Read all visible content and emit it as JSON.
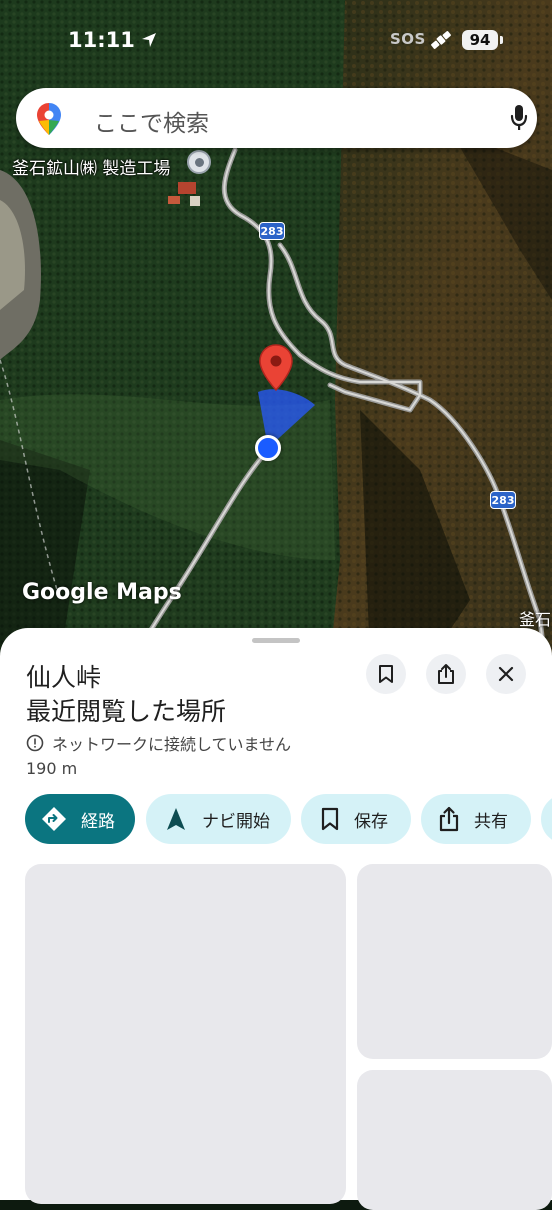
{
  "status_bar": {
    "time": "11:11",
    "sos": "SOS",
    "battery": "94"
  },
  "search": {
    "placeholder": "ここで検索"
  },
  "map": {
    "poi_label": "釜石鉱山㈱ 製造工場",
    "road_number": "283",
    "watermark": "Google Maps",
    "edge_label": "釜石"
  },
  "place": {
    "title_line1": "仙人峠",
    "title_line2": "最近閲覧した場所",
    "connection_status": "ネットワークに接続していません",
    "distance": "190 m"
  },
  "actions": [
    {
      "label": "経路",
      "icon": "directions-icon"
    },
    {
      "label": "ナビ開始",
      "icon": "navigation-arrow-icon"
    },
    {
      "label": "保存",
      "icon": "bookmark-icon"
    },
    {
      "label": "共有",
      "icon": "share-icon"
    }
  ],
  "colors": {
    "primary_chip": "#0b7580",
    "secondary_chip": "#d5f2f7",
    "marker": "#ea4335",
    "location_dot": "#1a5cff"
  }
}
